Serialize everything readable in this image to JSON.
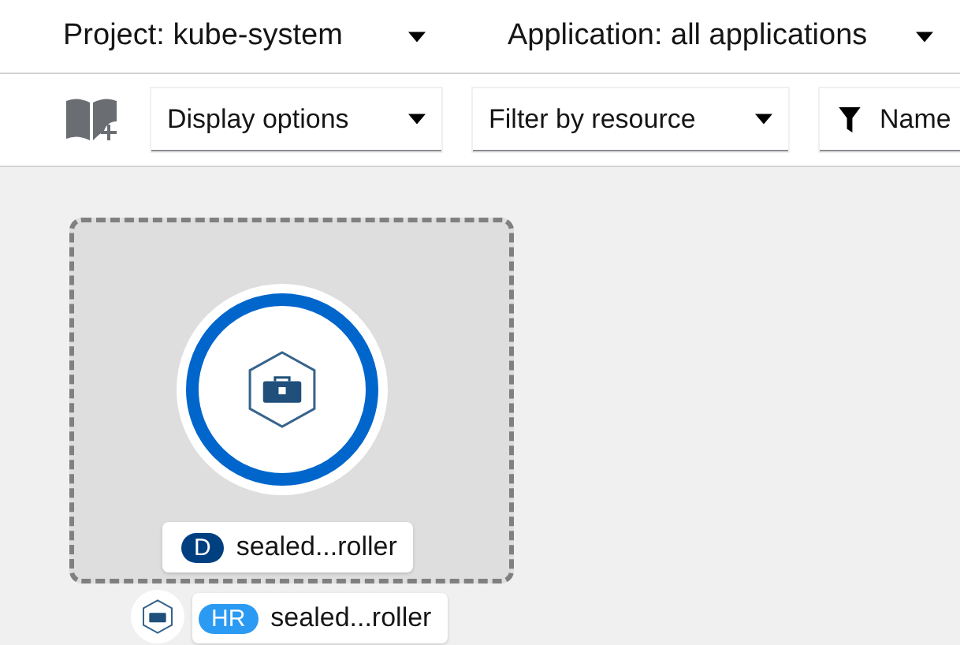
{
  "context_bar": {
    "project": {
      "label": "Project: kube-system"
    },
    "application": {
      "label": "Application: all applications"
    }
  },
  "toolbar": {
    "dropdowns": [
      {
        "label": "Display options"
      },
      {
        "label": "Filter by resource"
      }
    ],
    "filter": {
      "label": "Name"
    }
  },
  "topology": {
    "group": {
      "node": {
        "badge": {
          "text": "D",
          "color": "#004080"
        },
        "label": "sealed...roller"
      },
      "badge": {
        "text": "HR",
        "color": "#2b9af3"
      },
      "label": "sealed...roller"
    }
  }
}
